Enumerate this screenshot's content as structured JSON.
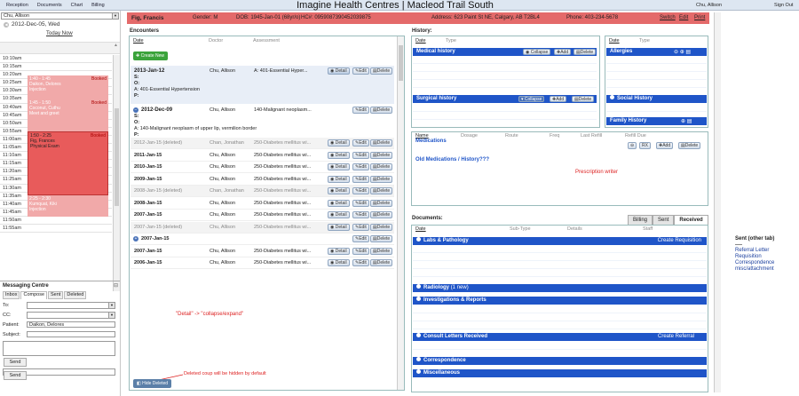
{
  "top_menu": [
    "Reception",
    "Documents",
    "Chart",
    "Billing"
  ],
  "app_title": "Imagine Health Centres | Macleod Trail South",
  "current_user": "Chu, Allison",
  "sign_out": "Sign Out",
  "left": {
    "provider_select": "Chu, Allison",
    "date": "2012-Dec-05, Wed",
    "today_now": "Today Now",
    "times": [
      "10:10am",
      "10:15am",
      "10:20am",
      "10:25am",
      "10:30am",
      "10:35am",
      "10:40am",
      "10:45am",
      "10:50am",
      "10:55am",
      "11:00am",
      "11:05am",
      "11:10am",
      "11:15am",
      "11:20am",
      "11:25am",
      "11:30am",
      "11:35am",
      "11:40am",
      "11:45am",
      "11:50am",
      "11:55am"
    ],
    "appts": [
      {
        "time": "1:40 - 1:45",
        "name": "Daikon, Delores",
        "type": "Injection",
        "booked": "Booked"
      },
      {
        "time": "1:45 - 1:50",
        "name": "Coconut, Cuthu",
        "type": "Meet and greet",
        "booked": "Booked"
      },
      {
        "time": "1:50 - 2:25",
        "name": "Fig, Frances",
        "type": "Physical Exam",
        "booked": "Booked"
      },
      {
        "time": "2:25 - 2:30",
        "name": "Kumquat, Kiki",
        "type": "Injection",
        "booked": "Booked"
      }
    ],
    "msg": {
      "title": "Messaging Centre",
      "tabs": [
        "Inbox",
        "Compose",
        "Sent",
        "Deleted"
      ],
      "to_label": "To:",
      "cc_label": "CC:",
      "patient_label": "Patient:",
      "patient_value": "Daikon, Delores",
      "subject_label": "Subject:",
      "send": "Send",
      "send2": "Send"
    }
  },
  "patient": {
    "name": "Fig, Francis",
    "gender": "Gender: M",
    "dob": "DOB: 1945-Jan-01 (68yr/o)",
    "hc": "HC#: 0959087390452039875",
    "address": "Address: 623 Paint St NE, Calgary, AB T2BL4",
    "phone": "Phone: 403-234-5678",
    "links": [
      "Switch",
      "Edit",
      "Print"
    ]
  },
  "encounters": {
    "title": "Encounters",
    "cols": [
      "Date",
      "Doctor",
      "Assessment"
    ],
    "create": "Create New",
    "first": {
      "date": "2013-Jan-12",
      "author": "Chu, Allison",
      "assess": "A: 401-Essential Hyper...",
      "soap": [
        "S:",
        "O:",
        "A: 401-Essential Hypertension",
        "P:"
      ]
    },
    "second": {
      "date": "2012-Dec-09",
      "author": "Chu, Allison",
      "assess": "140-Malignant neoplasm...",
      "soap": [
        "S:",
        "O:",
        "A: 140-Malignant neoplasm of upper lip, vermilion border",
        "P:"
      ]
    },
    "rows": [
      {
        "date": "2012-Jan-15 (deleted)",
        "author": "Chan, Jonathan",
        "assess": "250-Diabetes mellitus wi...",
        "del": true
      },
      {
        "date": "2011-Jan-15",
        "author": "Chu, Allison",
        "assess": "250-Diabetes mellitus wi..."
      },
      {
        "date": "2010-Jan-15",
        "author": "Chu, Allison",
        "assess": "250-Diabetes mellitus wi..."
      },
      {
        "date": "2009-Jan-15",
        "author": "Chu, Allison",
        "assess": "250-Diabetes mellitus wi..."
      },
      {
        "date": "2008-Jan-15 (deleted)",
        "author": "Chan, Jonathan",
        "assess": "250-Diabetes mellitus wi...",
        "del": true
      },
      {
        "date": "2008-Jan-15",
        "author": "Chu, Allison",
        "assess": "250-Diabetes mellitus wi..."
      },
      {
        "date": "2007-Jan-15",
        "author": "Chu, Allison",
        "assess": "250-Diabetes mellitus wi..."
      },
      {
        "date": "2007-Jan-15 (deleted)",
        "author": "Chu, Allison",
        "assess": "250-Diabetes mellitus wi...",
        "del": true
      },
      {
        "date": "2007-Jan-15",
        "author": "",
        "assess": "",
        "expand": true
      },
      {
        "date": "2007-Jan-15",
        "author": "Chu, Allison",
        "assess": "250-Diabetes mellitus wi..."
      },
      {
        "date": "2006-Jan-15",
        "author": "Chu, Allison",
        "assess": "250-Diabetes mellitus wi..."
      }
    ],
    "btn_detail": "Detail",
    "btn_edit": "Edit",
    "btn_delete": "Delete",
    "note1": "\"Detail\" -> \"collapse/expand\"",
    "note2": "Deleted coup will be hidden by default",
    "hide_deleted": "Hide Deleted"
  },
  "history": {
    "title": "History:",
    "cols": [
      "Date",
      "Type"
    ],
    "medical": "Medical history",
    "surgical": "Surgical history",
    "collapse": "Collapse",
    "add": "Add",
    "delete": "Delete",
    "allergies": "Allergies",
    "social": "Social History",
    "family": "Family History"
  },
  "meds": {
    "cols": [
      "Name",
      "Dosage",
      "Route",
      "Freq",
      "Last Refill",
      "Refill Due"
    ],
    "title": "Medications",
    "rx": "RX",
    "add": "Add",
    "delete": "Delete",
    "old": "Old Medications / History???",
    "writer": "Prescription writer"
  },
  "documents": {
    "title": "Documents:",
    "tabs": [
      "Billing",
      "Sent",
      "Received"
    ],
    "cols": [
      "Date",
      "Sub-Type",
      "Details",
      "Staff"
    ],
    "sections": [
      {
        "label": "Labs & Pathology",
        "action": "Create Requisition"
      },
      {
        "label": "Radiology",
        "extra": "(1 new)",
        "action": ""
      },
      {
        "label": "Investigations & Reports",
        "action": ""
      },
      {
        "label": "Consult Letters Received",
        "action": "Create Referral"
      },
      {
        "label": "Correspondence",
        "action": ""
      },
      {
        "label": "Miscellaneous",
        "action": ""
      }
    ]
  },
  "right": {
    "sent_tab": "Sent (other tab)",
    "items": [
      "Referral Letter",
      "Requisition",
      "Correspondence",
      "misc/attachment"
    ]
  }
}
